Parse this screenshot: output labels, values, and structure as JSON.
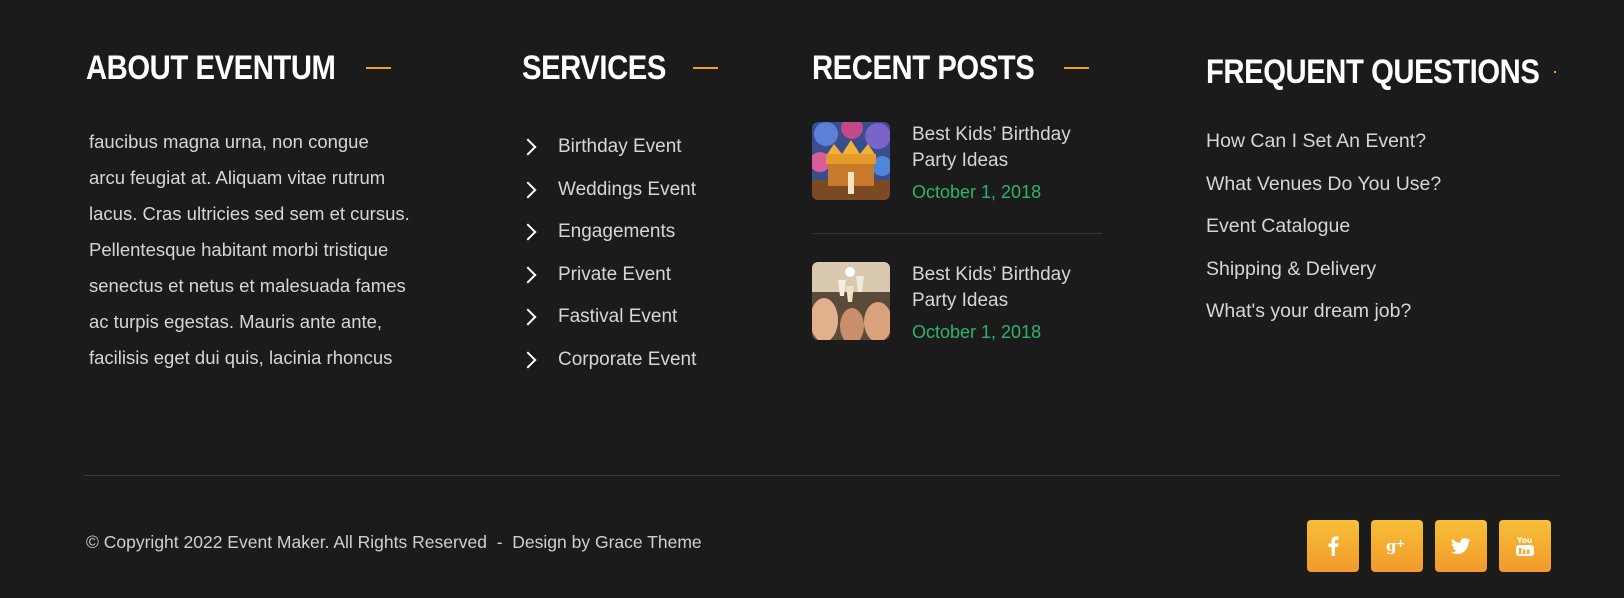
{
  "about": {
    "heading": "ABOUT EVENTUM",
    "lines": [
      "faucibus magna urna, non congue",
      "arcu feugiat at. Aliquam vitae rutrum",
      "lacus. Cras ultricies sed sem et cursus.",
      "Pellentesque habitant morbi tristique",
      "senectus et netus et malesuada fames",
      "ac turpis egestas. Mauris ante ante,",
      "facilisis eget dui quis, lacinia rhoncus"
    ]
  },
  "services": {
    "heading": "SERVICES",
    "items": [
      "Birthday Event",
      "Weddings Event",
      "Engagements",
      "Private Event",
      "Fastival Event",
      "Corporate Event"
    ]
  },
  "recent_posts": {
    "heading": "RECENT POSTS",
    "posts": [
      {
        "title": "Best Kids’ Birthday Party Ideas",
        "date": "October 1, 2018"
      },
      {
        "title": "Best Kids’ Birthday Party Ideas",
        "date": "October 1, 2018"
      }
    ]
  },
  "faq": {
    "heading": "FREQUENT QUESTIONS",
    "items": [
      "How Can I Set An Event?",
      "What Venues Do You Use?",
      "Event Catalogue",
      "Shipping & Delivery",
      "What's your dream job?"
    ]
  },
  "bottom": {
    "copyright": "© Copyright 2022 Event Maker. All Rights Reserved  -  Design by Grace Theme",
    "socials": [
      {
        "icon": "facebook-icon",
        "glyph": "f"
      },
      {
        "icon": "google-plus-icon",
        "glyph": "g+"
      },
      {
        "icon": "twitter-icon",
        "glyph": ""
      },
      {
        "icon": "youtube-icon",
        "glyph": "You"
      }
    ]
  },
  "colors": {
    "background": "#1b1b1b",
    "accent": "#f0a01e",
    "date": "#2fb36b",
    "social_top": "#f7bf37",
    "social_bottom": "#f29a2c"
  }
}
